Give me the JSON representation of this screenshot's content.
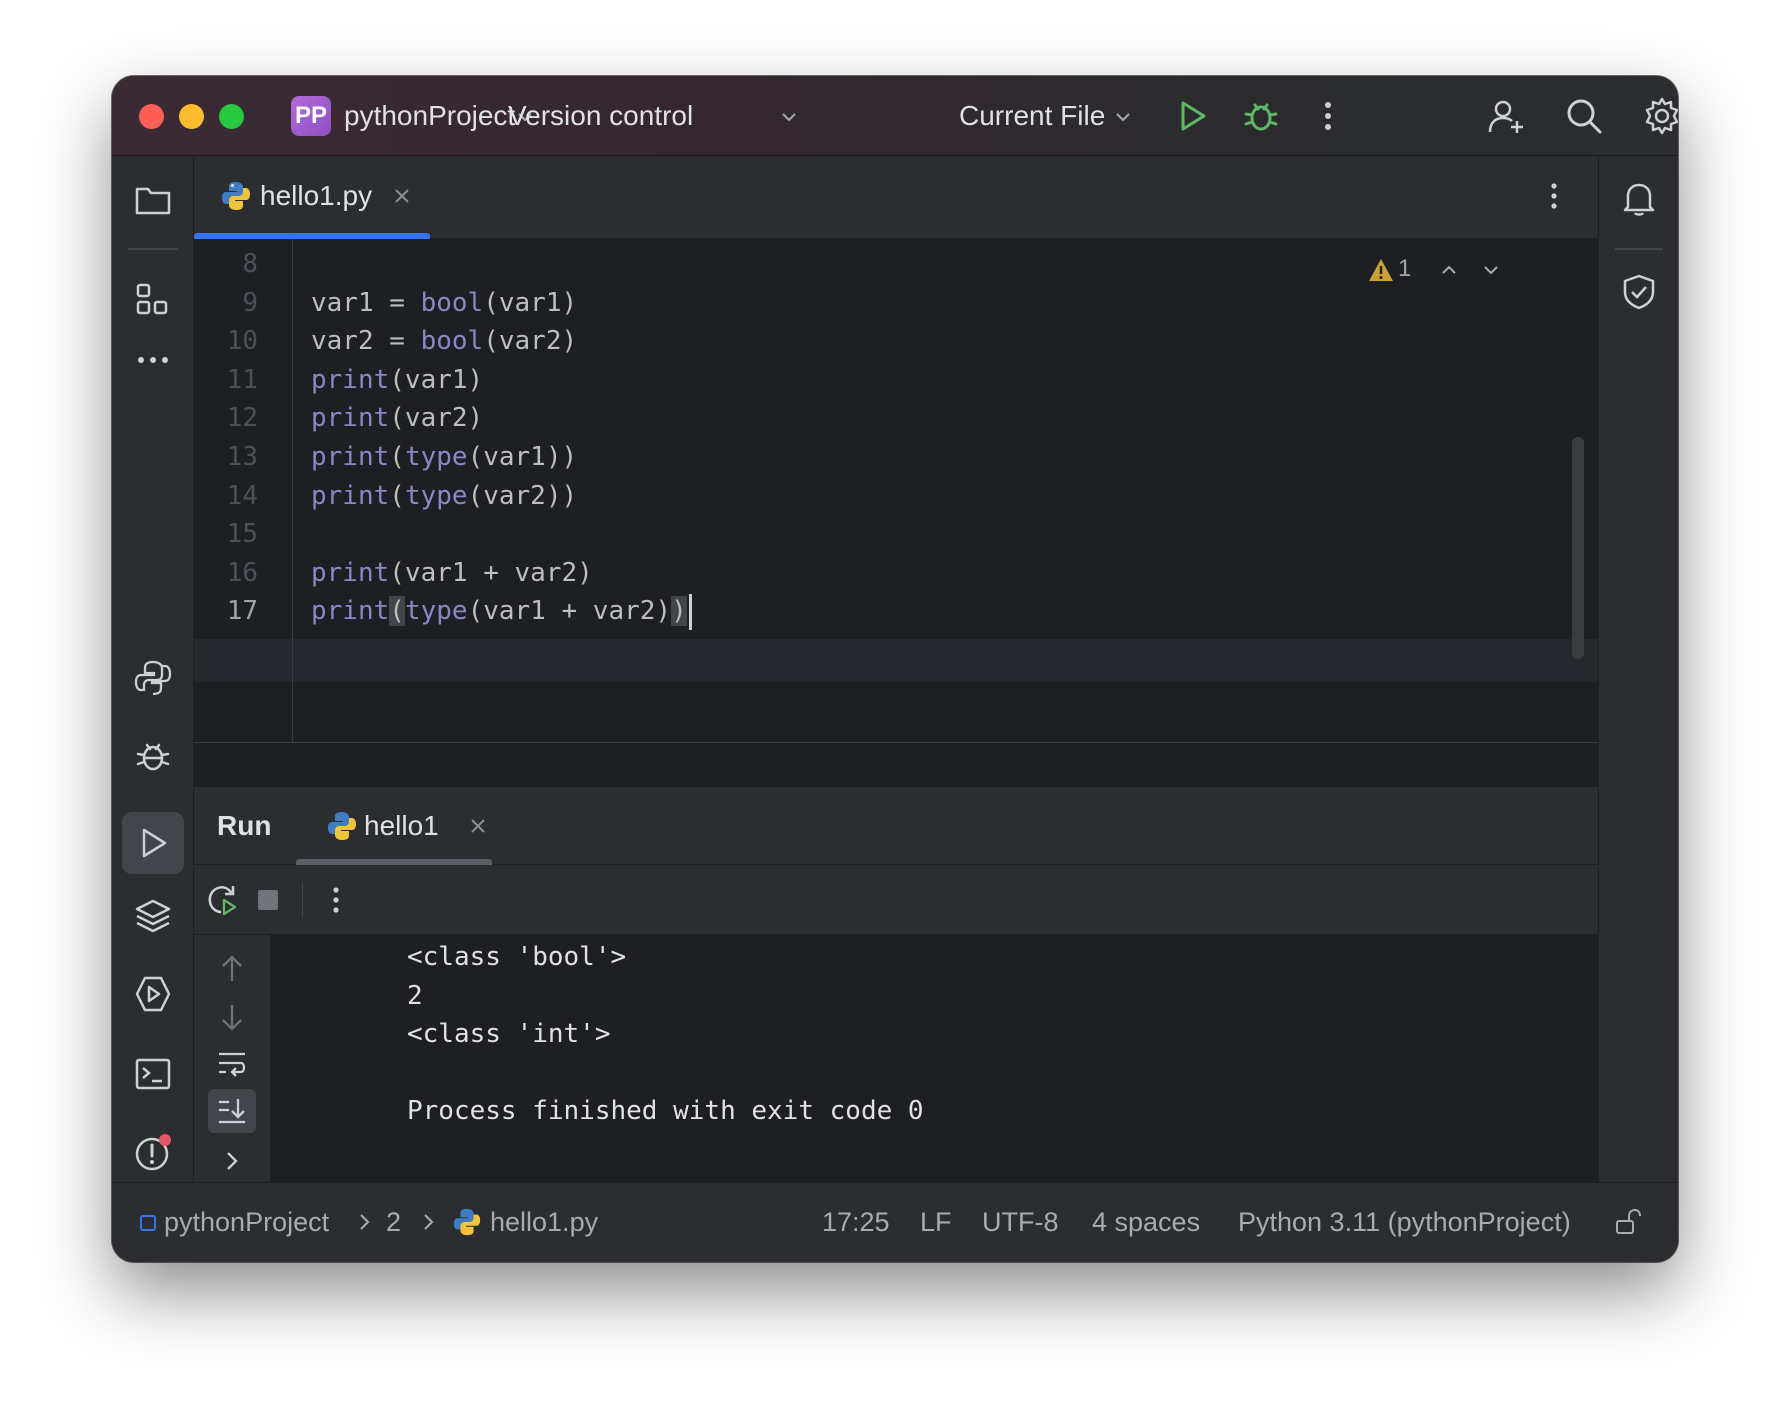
{
  "titlebar": {
    "project_badge": "PP",
    "project_name": "pythonProject",
    "vcs_label": "Version control",
    "run_config": "Current File"
  },
  "editor": {
    "tab_label": "hello1.py",
    "inspection_count": "1",
    "lines": [
      {
        "num": "8",
        "tokens": []
      },
      {
        "num": "9",
        "tokens": [
          {
            "t": "var1 = ",
            "c": "plain"
          },
          {
            "t": "bool",
            "c": "kw"
          },
          {
            "t": "(var1)",
            "c": "plain"
          }
        ]
      },
      {
        "num": "10",
        "tokens": [
          {
            "t": "var2 = ",
            "c": "plain"
          },
          {
            "t": "bool",
            "c": "kw"
          },
          {
            "t": "(var2)",
            "c": "plain"
          }
        ]
      },
      {
        "num": "11",
        "tokens": [
          {
            "t": "print",
            "c": "kw"
          },
          {
            "t": "(var1)",
            "c": "plain"
          }
        ]
      },
      {
        "num": "12",
        "tokens": [
          {
            "t": "print",
            "c": "kw"
          },
          {
            "t": "(var2)",
            "c": "plain"
          }
        ]
      },
      {
        "num": "13",
        "tokens": [
          {
            "t": "print",
            "c": "kw"
          },
          {
            "t": "(",
            "c": "plain"
          },
          {
            "t": "type",
            "c": "kw"
          },
          {
            "t": "(var1))",
            "c": "plain"
          }
        ]
      },
      {
        "num": "14",
        "tokens": [
          {
            "t": "print",
            "c": "kw"
          },
          {
            "t": "(",
            "c": "plain"
          },
          {
            "t": "type",
            "c": "kw"
          },
          {
            "t": "(var2))",
            "c": "plain"
          }
        ]
      },
      {
        "num": "15",
        "tokens": []
      },
      {
        "num": "16",
        "tokens": [
          {
            "t": "print",
            "c": "kw"
          },
          {
            "t": "(var1 + var2)",
            "c": "plain"
          }
        ]
      },
      {
        "num": "17",
        "current": true,
        "tokens": [
          {
            "t": "print",
            "c": "kw"
          },
          {
            "t": "(",
            "c": "paren"
          },
          {
            "t": "type",
            "c": "kw"
          },
          {
            "t": "(var1 + var2)",
            "c": "plain"
          },
          {
            "t": ")",
            "c": "paren"
          }
        ]
      }
    ]
  },
  "run": {
    "title": "Run",
    "tab_label": "hello1",
    "output": [
      "<class 'bool'>",
      "2",
      "<class 'int'>",
      "",
      "Process finished with exit code 0"
    ]
  },
  "statusbar": {
    "project": "pythonProject",
    "crumb_2": "2",
    "file": "hello1.py",
    "position": "17:25",
    "line_sep": "LF",
    "encoding": "UTF-8",
    "indent": "4 spaces",
    "interpreter": "Python 3.11 (pythonProject)"
  },
  "colors": {
    "accent": "#3574f0",
    "run_green": "#5fb865",
    "keyword": "#8888c6",
    "warning": "#c9a135",
    "error_dot": "#e55765"
  }
}
